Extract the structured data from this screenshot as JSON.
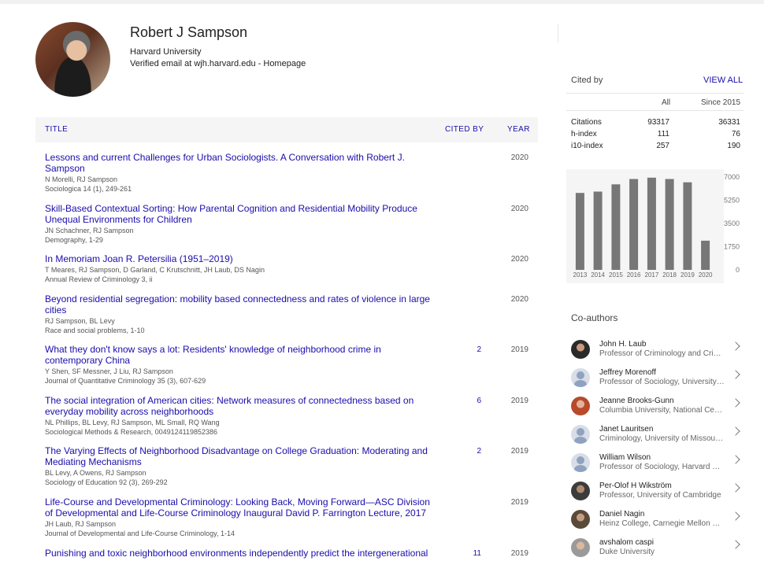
{
  "profile": {
    "name": "Robert J Sampson",
    "affiliation": "Harvard University",
    "email_text": "Verified email at wjh.harvard.edu - ",
    "homepage": "Homepage"
  },
  "table": {
    "headers": {
      "title": "TITLE",
      "cited_by": "CITED BY",
      "year": "YEAR"
    },
    "rows": [
      {
        "title": "Lessons and current Challenges for Urban Sociologists. A Conversation with Robert J. Sampson",
        "authors": "N Morelli, RJ Sampson",
        "venue": "Sociologica 14 (1), 249-261",
        "cited": "",
        "year": "2020"
      },
      {
        "title": "Skill-Based Contextual Sorting: How Parental Cognition and Residential Mobility Produce Unequal Environments for Children",
        "authors": "JN Schachner, RJ Sampson",
        "venue": "Demography, 1-29",
        "cited": "",
        "year": "2020"
      },
      {
        "title": "In Memoriam Joan R. Petersilia (1951–2019)",
        "authors": "T Meares, RJ Sampson, D Garland, C Krutschnitt, JH Laub, DS Nagin",
        "venue": "Annual Review of Criminology 3, ii",
        "cited": "",
        "year": "2020"
      },
      {
        "title": "Beyond residential segregation: mobility based connectedness and rates of violence in large cities",
        "authors": "RJ Sampson, BL Levy",
        "venue": "Race and social problems, 1-10",
        "cited": "",
        "year": "2020"
      },
      {
        "title": "What they don't know says a lot: Residents' knowledge of neighborhood crime in contemporary China",
        "authors": "Y Shen, SF Messner, J Liu, RJ Sampson",
        "venue": "Journal of Quantitative Criminology 35 (3), 607-629",
        "cited": "2",
        "year": "2019"
      },
      {
        "title": "The social integration of American cities: Network measures of connectedness based on everyday mobility across neighborhoods",
        "authors": "NL Phillips, BL Levy, RJ Sampson, ML Small, RQ Wang",
        "venue": "Sociological Methods & Research, 0049124119852386",
        "cited": "6",
        "year": "2019"
      },
      {
        "title": "The Varying Effects of Neighborhood Disadvantage on College Graduation: Moderating and Mediating Mechanisms",
        "authors": "BL Levy, A Owens, RJ Sampson",
        "venue": "Sociology of Education 92 (3), 269-292",
        "cited": "2",
        "year": "2019"
      },
      {
        "title": "Life-Course and Developmental Criminology: Looking Back, Moving Forward—ASC Division of Developmental and Life-Course Criminology Inaugural David P. Farrington Lecture, 2017",
        "authors": "JH Laub, RJ Sampson",
        "venue": "Journal of Developmental and Life-Course Criminology, 1-14",
        "cited": "",
        "year": "2019"
      },
      {
        "title": "Punishing and toxic neighborhood environments independently predict the intergenerational",
        "authors": "",
        "venue": "",
        "cited": "11",
        "year": "2019"
      }
    ]
  },
  "cited_by": {
    "title": "Cited by",
    "view_all": "VIEW ALL",
    "col_all": "All",
    "col_since": "Since 2015",
    "metrics": [
      {
        "label": "Citations",
        "all": "93317",
        "since": "36331"
      },
      {
        "label": "h-index",
        "all": "111",
        "since": "76"
      },
      {
        "label": "i10-index",
        "all": "257",
        "since": "190"
      }
    ]
  },
  "chart_data": {
    "type": "bar",
    "categories": [
      "2013",
      "2014",
      "2015",
      "2016",
      "2017",
      "2018",
      "2019",
      "2020"
    ],
    "values": [
      5800,
      5900,
      6450,
      6850,
      6950,
      6850,
      6600,
      2200
    ],
    "ylim": [
      0,
      7000
    ],
    "yticks": [
      "7000",
      "5250",
      "3500",
      "1750",
      "0"
    ],
    "ytick_values": [
      7000,
      5250,
      3500,
      1750,
      0
    ],
    "bar_color": "#777777"
  },
  "coauthors": {
    "title": "Co-authors",
    "items": [
      {
        "name": "John H. Laub",
        "affiliation": "Professor of Criminology and Criminal Justice",
        "avatar": "photo1"
      },
      {
        "name": "Jeffrey Morenoff",
        "affiliation": "Professor of Sociology, University of Michigan",
        "avatar": "placeholder"
      },
      {
        "name": "Jeanne Brooks-Gunn",
        "affiliation": "Columbia University, National Center for Children",
        "avatar": "photo2"
      },
      {
        "name": "Janet Lauritsen",
        "affiliation": "Criminology, University of Missouri - St. Louis",
        "avatar": "placeholder"
      },
      {
        "name": "William Wilson",
        "affiliation": "Professor of Sociology, Harvard University",
        "avatar": "placeholder"
      },
      {
        "name": "Per-Olof H Wikström",
        "affiliation": "Professor, University of Cambridge",
        "avatar": "photo3"
      },
      {
        "name": "Daniel Nagin",
        "affiliation": "Heinz College, Carnegie Mellon University",
        "avatar": "photo4"
      },
      {
        "name": "avshalom caspi",
        "affiliation": "Duke University",
        "avatar": "photo5"
      }
    ]
  }
}
